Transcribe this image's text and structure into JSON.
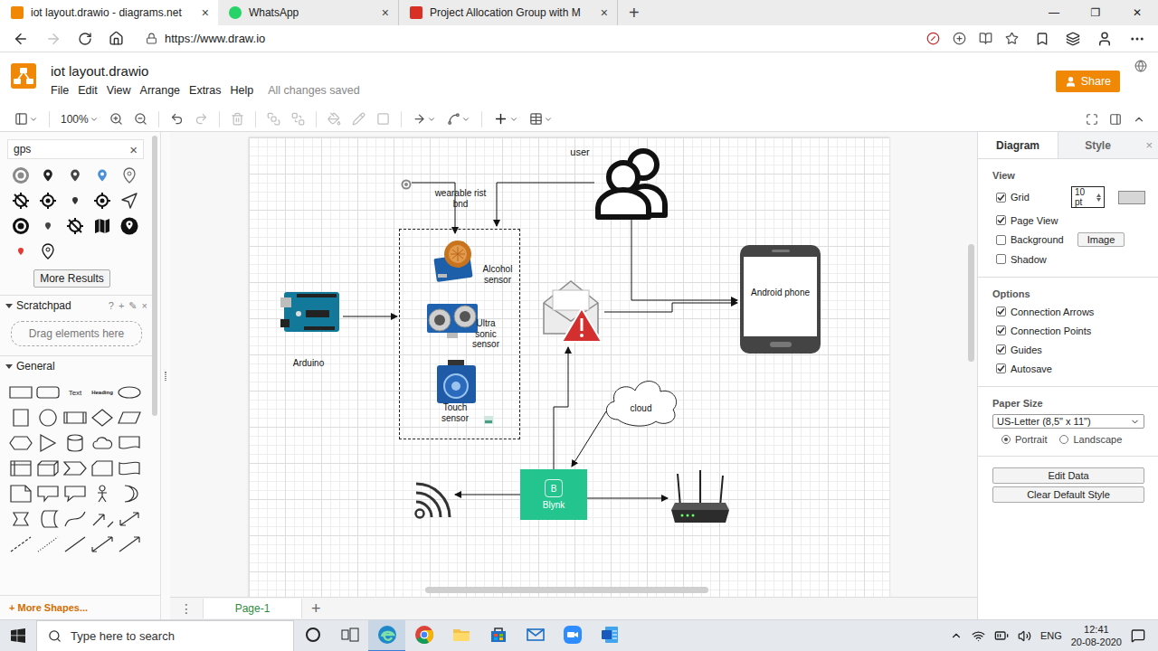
{
  "browser": {
    "tabs": [
      {
        "title": "iot layout.drawio - diagrams.net",
        "selected": true,
        "close": "×"
      },
      {
        "title": "WhatsApp",
        "selected": false,
        "close": "×"
      },
      {
        "title": "Project Allocation Group with M",
        "selected": false,
        "close": "×"
      }
    ],
    "new_tab": "+",
    "window_controls": [
      "—",
      "❐",
      "✕"
    ],
    "url": "https://www.draw.io",
    "back_disabled": false,
    "forward_disabled": true
  },
  "app": {
    "title": "iot layout.drawio",
    "menu": [
      "File",
      "Edit",
      "View",
      "Arrange",
      "Extras",
      "Help"
    ],
    "status": "All changes saved",
    "share": "Share"
  },
  "toolbar": {
    "zoom": "100%",
    "undo_disabled": false,
    "redo_disabled": true,
    "delete_disabled": true,
    "arrange_disabled": true,
    "style_disabled": true
  },
  "sidebar": {
    "search": "gps",
    "clear": "×",
    "more_results": "More Results",
    "scratchpad": {
      "title": "Scratchpad",
      "expanded": true,
      "tools": [
        "?",
        "+",
        "✎",
        "×"
      ],
      "hint": "Drag elements here"
    },
    "general": {
      "title": "General",
      "expanded": true,
      "shape_labels": [
        "Text",
        "Heading"
      ]
    },
    "more_shapes": "+ More Shapes..."
  },
  "diagram": {
    "nodes": [
      {
        "kind": "text",
        "label": "user"
      },
      {
        "kind": "person"
      },
      {
        "kind": "gps"
      },
      {
        "kind": "text",
        "label": "wearable rist bnd"
      },
      {
        "kind": "group"
      },
      {
        "kind": "alcohol"
      },
      {
        "kind": "text",
        "label": "Alcohol sensor"
      },
      {
        "kind": "ultrasonic"
      },
      {
        "kind": "text",
        "label": "Ultra sonic sensor"
      },
      {
        "kind": "touch"
      },
      {
        "kind": "text",
        "label": "Touch sensor"
      },
      {
        "kind": "thumbnail"
      },
      {
        "kind": "arduino"
      },
      {
        "kind": "text",
        "label": "Arduino"
      },
      {
        "kind": "mail"
      },
      {
        "kind": "phone",
        "label": "Android phone"
      },
      {
        "kind": "cloud",
        "label": "cloud"
      },
      {
        "kind": "blynk",
        "label": "Blynk",
        "logo": "B"
      },
      {
        "kind": "wifi"
      },
      {
        "kind": "router"
      }
    ]
  },
  "format_panel": {
    "tabs": [
      {
        "label": "Diagram",
        "selected": true
      },
      {
        "label": "Style",
        "selected": false
      }
    ],
    "close": "×",
    "view": {
      "title": "View",
      "options": [
        {
          "label": "Grid",
          "checked": true,
          "kind": "grid",
          "value": "10 pt"
        },
        {
          "label": "Page View",
          "checked": true,
          "kind": "plain"
        },
        {
          "label": "Background",
          "checked": false,
          "kind": "image",
          "button": "Image"
        },
        {
          "label": "Shadow",
          "checked": false,
          "kind": "plain"
        }
      ]
    },
    "options": {
      "title": "Options",
      "items": [
        {
          "label": "Connection Arrows",
          "checked": true
        },
        {
          "label": "Connection Points",
          "checked": true
        },
        {
          "label": "Guides",
          "checked": true
        },
        {
          "label": "Autosave",
          "checked": true
        }
      ]
    },
    "paper_size": {
      "title": "Paper Size",
      "value": "US-Letter (8,5\" x 11\")",
      "orientations": [
        {
          "label": "Portrait",
          "selected": true
        },
        {
          "label": "Landscape",
          "selected": false
        }
      ]
    },
    "buttons": [
      "Edit Data",
      "Clear Default Style"
    ]
  },
  "pages": {
    "menu": "⋮",
    "tabs": [
      {
        "label": "Page-1",
        "selected": true
      }
    ],
    "add": "+"
  },
  "taskbar": {
    "search": "Type here to search",
    "apps": [
      {
        "active": true
      },
      {
        "active": false
      },
      {
        "active": false
      },
      {
        "active": false
      },
      {
        "active": false
      },
      {
        "active": false
      },
      {
        "active": false
      }
    ],
    "language": "ENG",
    "time": "12:41",
    "date": "20-08-2020"
  }
}
